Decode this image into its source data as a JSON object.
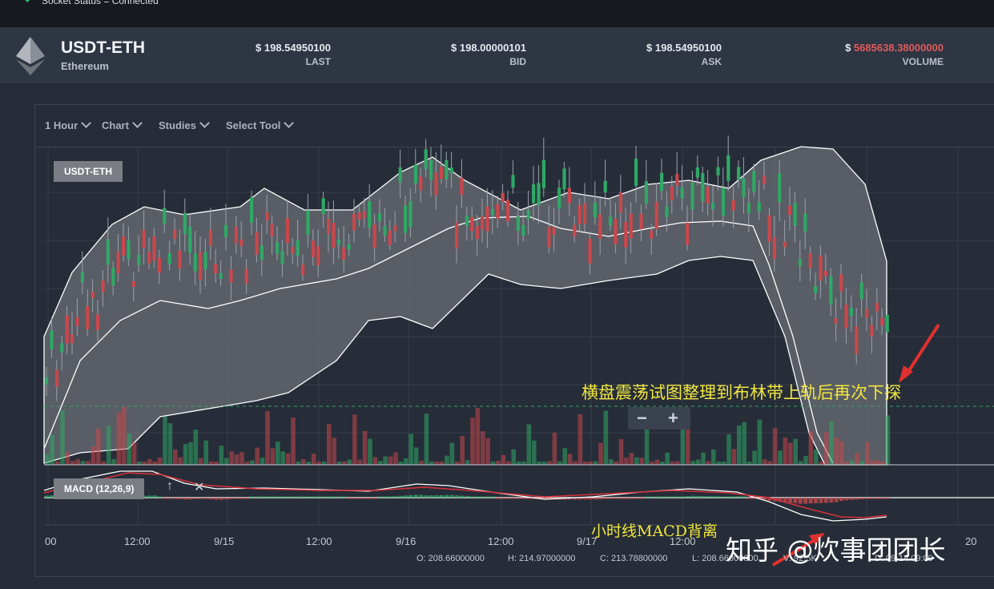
{
  "status": {
    "text": "Socket Status = Connected"
  },
  "header": {
    "pair": "USDT-ETH",
    "network": "Ethereum",
    "stats": [
      {
        "value": "$ 198.54950100",
        "label": "LAST",
        "red": false
      },
      {
        "value": "$ 198.00000101",
        "label": "BID",
        "red": false
      },
      {
        "value": "$ 198.54950100",
        "label": "ASK",
        "red": false
      },
      {
        "value_prefix": "$ ",
        "value": "5685638.38000000",
        "label": "VOLUME",
        "red": true
      }
    ]
  },
  "toolbar": {
    "interval": "1 Hour",
    "chart": "Chart",
    "studies": "Studies",
    "tool": "Select Tool"
  },
  "chart_badge": "USDT-ETH",
  "macd_badge": "MACD (12,26,9)",
  "annotations": {
    "main": "横盘震荡试图整理到布林带上轨后再次下探",
    "macd": "小时线MACD背离"
  },
  "watermark": "知乎 @炊事团团长",
  "x_labels": [
    "00",
    "12:00",
    "9/15",
    "12:00",
    "9/16",
    "12:00",
    "9/17",
    "12:00",
    "20"
  ],
  "ohlc": {
    "o": "O:  208.66000000",
    "h": "H:  214.97000000",
    "c": "C:  213.78800000",
    "l": "L:  208.66000000",
    "v": "V:    92.5K",
    "d": "D:  09-14 09:00"
  },
  "colors": {
    "up": "#2fa866",
    "down": "#c9474c",
    "band": "#6b6e74",
    "accent": "#f2e640"
  }
}
